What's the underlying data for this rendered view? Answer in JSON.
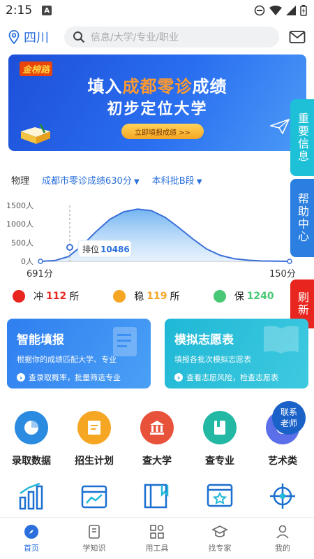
{
  "status": {
    "time": "2:15"
  },
  "header": {
    "location": "四川",
    "search_placeholder": "信息/大学/专业/职业"
  },
  "banner": {
    "logo": "金榜路",
    "line1_a": "填入",
    "line1_hl": "成都零诊",
    "line1_b": "成绩",
    "line2": "初步定位大学",
    "cta": "立即填报成绩 >>"
  },
  "side_tabs": {
    "important": "重要信息",
    "help": "帮助中心",
    "refresh": "刷新"
  },
  "filters": {
    "subject": "物理",
    "exam": "成都市零诊成绩630分",
    "batch": "本科批B段"
  },
  "chart_data": {
    "type": "area",
    "y_ticks": [
      "1500人",
      "1000人",
      "500人",
      "0人"
    ],
    "ylim": [
      0,
      1500
    ],
    "x_left_label": "691分",
    "x_right_label": "150分",
    "rank_label": "排位",
    "rank_value": "10486",
    "x": [
      691,
      660,
      630,
      600,
      570,
      540,
      510,
      480,
      450,
      420,
      390,
      360,
      330,
      300,
      270,
      240,
      210,
      180,
      150
    ],
    "values": [
      0,
      20,
      130,
      430,
      800,
      1130,
      1330,
      1400,
      1360,
      1180,
      900,
      600,
      330,
      160,
      70,
      30,
      10,
      5,
      0
    ]
  },
  "legend": {
    "chong": {
      "label": "冲",
      "count": "112",
      "unit": "所",
      "color": "#e8251e"
    },
    "wen": {
      "label": "稳",
      "count": "119",
      "unit": "所",
      "color": "#f5a623"
    },
    "bao": {
      "label": "保",
      "count": "1240",
      "color": "#48c774"
    }
  },
  "cards": {
    "smart": {
      "title": "智能填报",
      "sub": "根据你的成绩匹配大学、专业",
      "link": "查录取概率，批量筛选专业"
    },
    "sim": {
      "title": "模拟志愿表",
      "sub": "填报各批次模拟志愿表",
      "link": "查看志愿风险，检查志愿表"
    }
  },
  "grid": [
    "录取数据",
    "招生计划",
    "查大学",
    "查专业",
    "艺术类"
  ],
  "contact": {
    "line1": "联系",
    "line2": "老师"
  },
  "tabs": [
    "首页",
    "学知识",
    "用工具",
    "找专家",
    "我的"
  ],
  "colors": {
    "brand": "#2a6fdb",
    "side_cyan": "#1ec0d8",
    "side_blue": "#2a7fe0",
    "side_red": "#e8251e"
  }
}
